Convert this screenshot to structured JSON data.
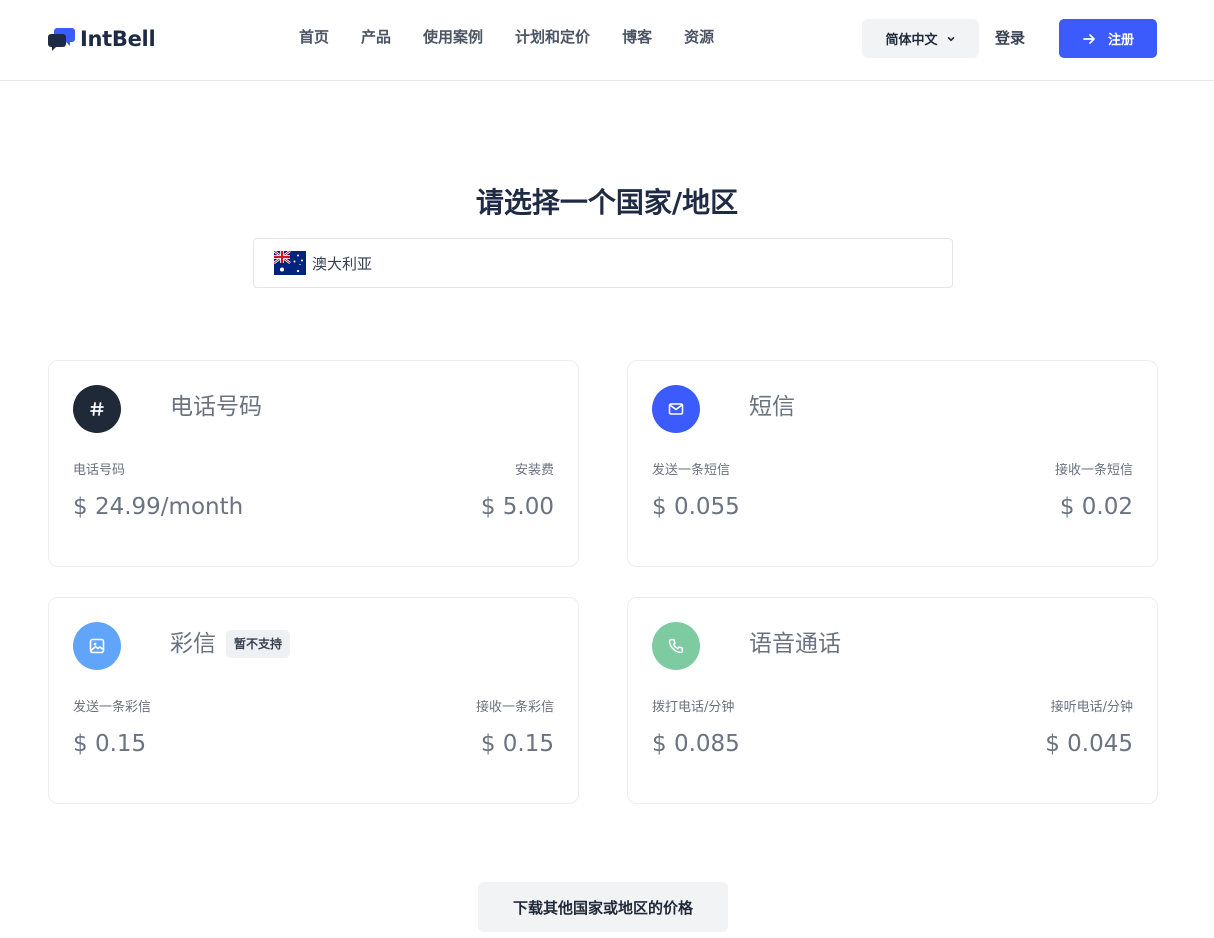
{
  "header": {
    "logo_text": "IntBell",
    "nav": [
      "首页",
      "产品",
      "使用案例",
      "计划和定价",
      "博客",
      "资源"
    ],
    "language": "简体中文",
    "login": "登录",
    "signup": "注册"
  },
  "main": {
    "title": "请选择一个国家/地区",
    "country": {
      "name": "澳大利亚",
      "flag": "australia-flag"
    }
  },
  "cards": {
    "phone": {
      "title": "电话号码",
      "icon": "hash-icon",
      "left_label": "电话号码",
      "left_value": "$ 24.99/month",
      "right_label": "安装费",
      "right_value": "$ 5.00"
    },
    "sms": {
      "title": "短信",
      "icon": "mail-icon",
      "left_label": "发送一条短信",
      "left_value": "$ 0.055",
      "right_label": "接收一条短信",
      "right_value": "$ 0.02"
    },
    "mms": {
      "title": "彩信",
      "badge": "暂不支持",
      "icon": "image-icon",
      "left_label": "发送一条彩信",
      "left_value": "$ 0.15",
      "right_label": "接收一条彩信",
      "right_value": "$ 0.15"
    },
    "voice": {
      "title": "语音通话",
      "icon": "phone-icon",
      "left_label": "拨打电话/分钟",
      "left_value": "$ 0.085",
      "right_label": "接听电话/分钟",
      "right_value": "$ 0.045"
    }
  },
  "download": "下载其他国家或地区的价格",
  "colors": {
    "accent": "#3b5bfc",
    "dark": "#1f2a44",
    "phone_icon_bg": "#1f2937",
    "sms_icon_bg": "#3b5bfc",
    "mms_icon_bg": "#60a5fa",
    "voice_icon_bg": "#7ecba1"
  }
}
